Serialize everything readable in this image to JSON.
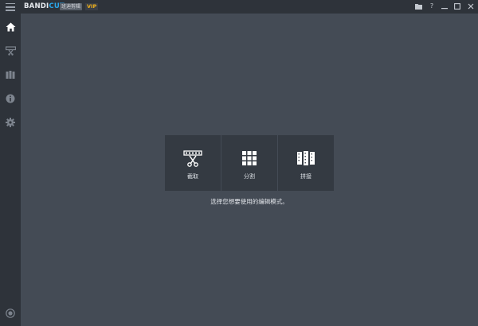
{
  "app": {
    "logo_bandi": "BANDI",
    "logo_cut": "CUT",
    "subtitle_badge": "班迪剪辑",
    "vip_badge": "VIP"
  },
  "window_controls": {
    "folder": "folder-icon",
    "help": "?",
    "minimize": "—",
    "maximize": "▢",
    "close": "✕"
  },
  "sidebar": {
    "items": [
      {
        "name": "home",
        "icon": "home-icon",
        "active": true
      },
      {
        "name": "cut",
        "icon": "cut-icon",
        "active": false
      },
      {
        "name": "split",
        "icon": "split-icon",
        "active": false
      },
      {
        "name": "info",
        "icon": "info-icon",
        "active": false
      },
      {
        "name": "settings",
        "icon": "gear-icon",
        "active": false
      }
    ],
    "bottom_icon": "record-icon"
  },
  "modes": [
    {
      "label": "截取",
      "icon": "trim-icon"
    },
    {
      "label": "分割",
      "icon": "grid-split-icon"
    },
    {
      "label": "拼接",
      "icon": "join-icon"
    }
  ],
  "hint_text": "选择您想要使用的编辑模式。",
  "colors": {
    "accent": "#2aa6ea",
    "vip": "#f0b11a",
    "background": "#444b55",
    "sidebar": "#2e333a",
    "tile": "#343a42"
  }
}
